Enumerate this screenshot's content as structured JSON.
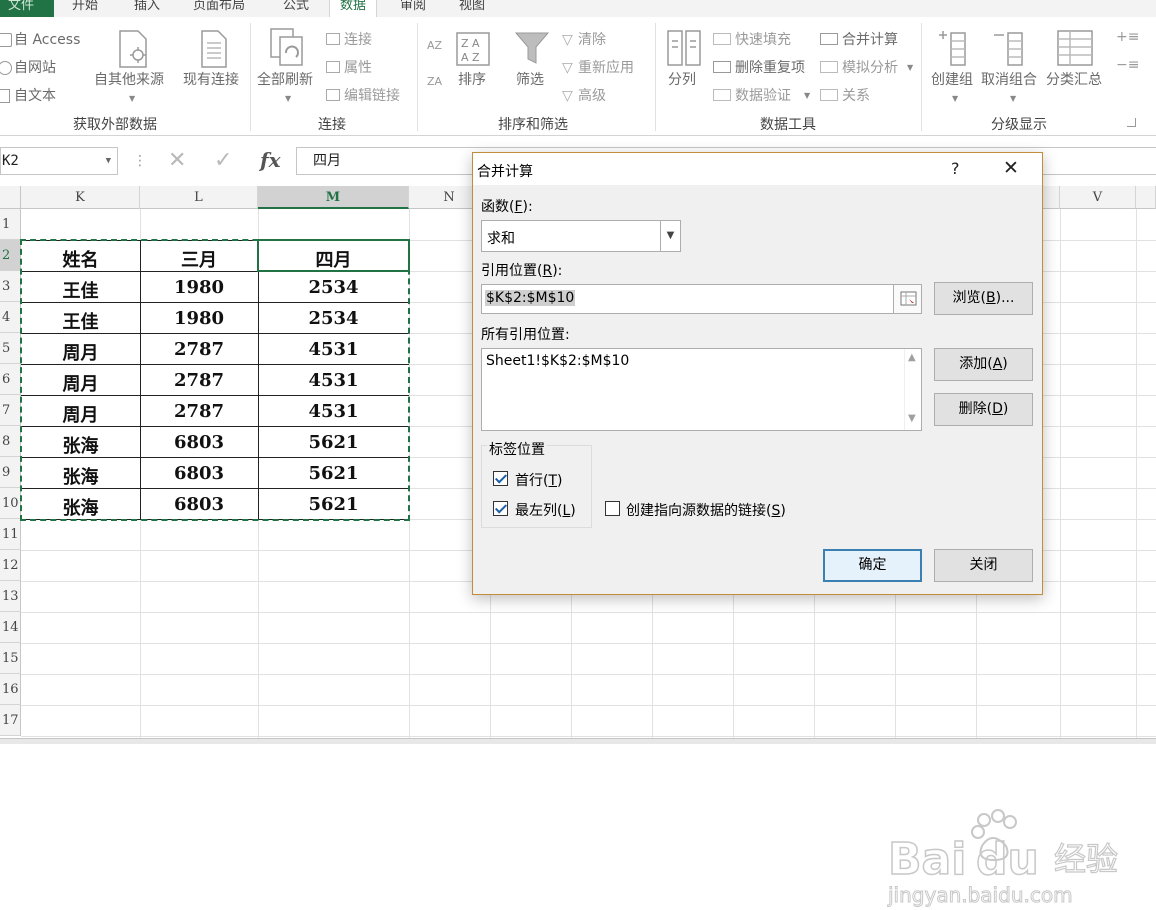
{
  "ribbon": {
    "tabs": [
      "文件",
      "开始",
      "插入",
      "页面布局",
      "公式",
      "数据",
      "审阅",
      "视图"
    ],
    "active_tab": "数据",
    "get_external": {
      "access": "自 Access",
      "web": "自网站",
      "text": "自文本",
      "other": "自其他来源",
      "existing": "现有连接",
      "group_label": "获取外部数据"
    },
    "connections": {
      "refresh_all": "全部刷新",
      "connections": "连接",
      "properties": "属性",
      "edit_links": "编辑链接",
      "group_label": "连接"
    },
    "sort_filter": {
      "sort": "排序",
      "filter": "筛选",
      "clear": "清除",
      "reapply": "重新应用",
      "advanced": "高级",
      "group_label": "排序和筛选"
    },
    "data_tools": {
      "text_to_columns": "分列",
      "flash_fill": "快速填充",
      "remove_duplicates": "删除重复项",
      "data_validation": "数据验证",
      "consolidate": "合并计算",
      "what_if": "模拟分析",
      "relationships": "关系",
      "group_label": "数据工具"
    },
    "outline": {
      "group": "创建组",
      "ungroup": "取消组合",
      "subtotal": "分类汇总",
      "group_label": "分级显示"
    }
  },
  "formula_bar": {
    "name_box": "K2",
    "fx": "fx",
    "content": "四月"
  },
  "grid": {
    "columns": [
      "K",
      "L",
      "M",
      "N",
      "V"
    ],
    "selected_column": "M",
    "rows": [
      "1",
      "2",
      "3",
      "4",
      "5",
      "6",
      "7",
      "8",
      "9",
      "10",
      "11",
      "12",
      "13",
      "14",
      "15",
      "16",
      "17"
    ],
    "table": {
      "header": [
        "姓名",
        "三月",
        "四月"
      ],
      "rows": [
        [
          "王佳",
          "1980",
          "2534"
        ],
        [
          "王佳",
          "1980",
          "2534"
        ],
        [
          "周月",
          "2787",
          "4531"
        ],
        [
          "周月",
          "2787",
          "4531"
        ],
        [
          "周月",
          "2787",
          "4531"
        ],
        [
          "张海",
          "6803",
          "5621"
        ],
        [
          "张海",
          "6803",
          "5621"
        ],
        [
          "张海",
          "6803",
          "5621"
        ]
      ]
    }
  },
  "dialog": {
    "title": "合并计算",
    "help": "?",
    "function_label": "函数",
    "function_key": "F",
    "function_value": "求和",
    "reference_label": "引用位置",
    "reference_key": "R",
    "reference_value": "$K$2:$M$10",
    "browse_label": "浏览",
    "browse_key": "B",
    "all_references_label": "所有引用位置:",
    "all_references": [
      "Sheet1!$K$2:$M$10"
    ],
    "add_label": "添加",
    "add_key": "A",
    "delete_label": "删除",
    "delete_key": "D",
    "use_labels_title": "标签位置",
    "top_row_label": "首行",
    "top_row_key": "T",
    "top_row_checked": true,
    "left_column_label": "最左列",
    "left_column_key": "L",
    "left_column_checked": true,
    "link_source_label": "创建指向源数据的链接",
    "link_source_key": "S",
    "link_source_checked": false,
    "ok_label": "确定",
    "close_label": "关闭"
  },
  "watermark": {
    "brand": "Bai",
    "brand2": "du",
    "cn": "经验",
    "url": "jingyan.baidu.com"
  },
  "colors": {
    "excel_green": "#217346",
    "annotation_arrow": "#e53935",
    "dialog_border": "#c28d3a"
  }
}
